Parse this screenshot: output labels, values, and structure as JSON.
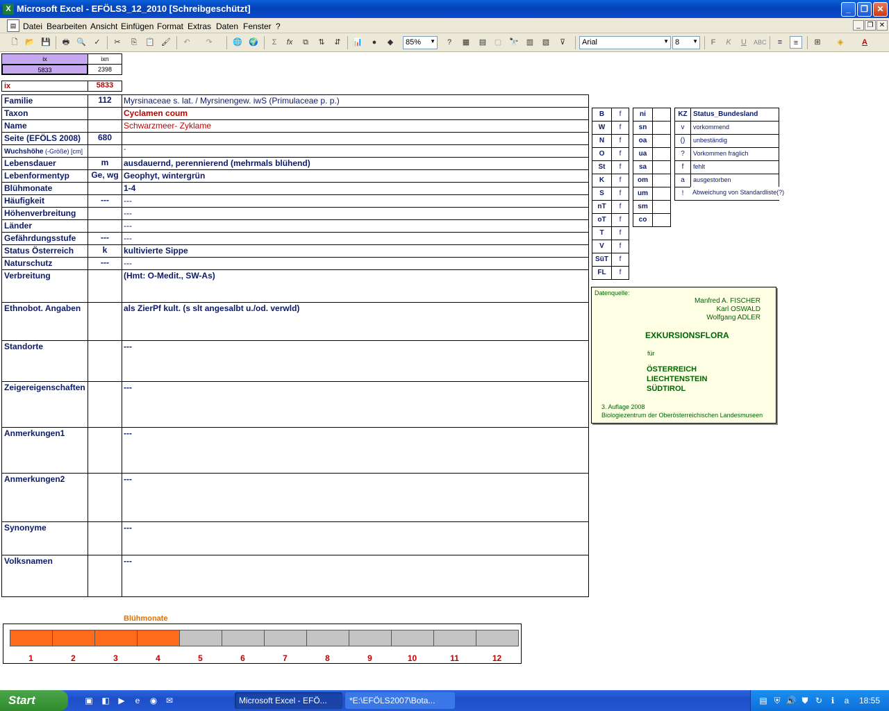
{
  "window": {
    "title": "Microsoft Excel - EFÖLS3_12_2010  [Schreibgeschützt]"
  },
  "menu": [
    "Datei",
    "Bearbeiten",
    "Ansicht",
    "Einfügen",
    "Format",
    "Extras",
    "Daten",
    "Fenster",
    "?"
  ],
  "toolbar": {
    "zoom": "85%",
    "font": "Arial",
    "size": "8"
  },
  "idx": {
    "ix_label": "ix",
    "ixn_label": "ixn",
    "ix_value": "5833",
    "ixn_value": "2398",
    "ix_label2": "ix",
    "ix_value2": "5833"
  },
  "rows": [
    {
      "label": "Familie",
      "code": "112",
      "value": "Myrsinaceae s. lat.  /  Myrsinengew. iwS (Primulaceae p. p.)"
    },
    {
      "label": "Taxon",
      "code": "",
      "value": "Cyclamen coum"
    },
    {
      "label": "Name",
      "code": "",
      "value": "Schwarzmeer- Zyklame"
    },
    {
      "label": "Seite (EFÖLS 2008)",
      "code": "680",
      "value": ""
    },
    {
      "label": "Wuchshöhe",
      "label_suffix": " (-Größe) [cm]",
      "code": "",
      "value": " -"
    },
    {
      "label": "Lebensdauer",
      "code": "m",
      "value": "ausdauernd, perennierend (mehrmals blühend)"
    },
    {
      "label": "Lebenformentyp",
      "code": "Ge, wg",
      "value": "Geophyt, wintergrün"
    },
    {
      "label": "Blühmonate",
      "code": "",
      "value": " 1-4"
    },
    {
      "label": "Häufigkeit",
      "code": "---",
      "value": " ---"
    },
    {
      "label": "Höhenverbreitung",
      "code": "",
      "value": " ---"
    },
    {
      "label": "Länder",
      "code": "",
      "value": " ---"
    },
    {
      "label": "Gefährdungsstufe",
      "code": "---",
      "value": "  ---"
    },
    {
      "label": "Status Österreich",
      "code": "k",
      "value": "kultivierte Sippe"
    },
    {
      "label": "Naturschutz",
      "code": "---",
      "value": " ---"
    },
    {
      "label": "Verbreitung",
      "code": "",
      "value": "(Hmt: O-Medit., SW-As)"
    },
    {
      "label": "Ethnobot. Angaben",
      "code": "",
      "value": "als ZierPf kult. (s slt angesalbt u./od. verwld)"
    },
    {
      "label": "Standorte",
      "code": "",
      "value": "---"
    },
    {
      "label": "Zeigereigenschaften",
      "code": "",
      "value": "---"
    },
    {
      "label": "Anmerkungen1",
      "code": "",
      "value": "---"
    },
    {
      "label": "Anmerkungen2",
      "code": "",
      "value": "---"
    },
    {
      "label": "Synonyme",
      "code": "",
      "value": "---"
    },
    {
      "label": "Volksnamen",
      "code": "",
      "value": "---"
    }
  ],
  "states": [
    {
      "code": "B",
      "flag": "f"
    },
    {
      "code": "W",
      "flag": "f"
    },
    {
      "code": "N",
      "flag": "f"
    },
    {
      "code": "O",
      "flag": "f"
    },
    {
      "code": "St",
      "flag": "f"
    },
    {
      "code": "K",
      "flag": "f"
    },
    {
      "code": "S",
      "flag": "f"
    },
    {
      "code": "nT",
      "flag": "f"
    },
    {
      "code": "oT",
      "flag": "f"
    },
    {
      "code": "T",
      "flag": "f"
    },
    {
      "code": "V",
      "flag": "f"
    },
    {
      "code": "SüT",
      "flag": "f"
    },
    {
      "code": "FL",
      "flag": "f"
    }
  ],
  "regions": [
    "ni",
    "sn",
    "oa",
    "ua",
    "sa",
    "om",
    "um",
    "sm",
    "co"
  ],
  "legend": {
    "header_kz": "KZ",
    "header_name": "Status_Bundesland",
    "items": [
      {
        "kz": "v",
        "text": "vorkommend"
      },
      {
        "kz": "()",
        "text": "unbeständig"
      },
      {
        "kz": "?",
        "text": "Vorkommen fraglich"
      },
      {
        "kz": "f",
        "text": "fehlt"
      },
      {
        "kz": "a",
        "text": "ausgestorben"
      },
      {
        "kz": "!",
        "text": "Abweichung von Standardliste(?)"
      }
    ]
  },
  "datasource": {
    "label": "Datenquelle:",
    "author1": "Manfred A. FISCHER",
    "author2": "Karl OSWALD",
    "author3": "Wolfgang ADLER",
    "title": "EXKURSIONSFLORA",
    "fuer": "für",
    "country1": "ÖSTERREICH",
    "country2": "LIECHTENSTEIN",
    "country3": "SÜDTIROL",
    "edition": "3. Auflage 2008",
    "publisher": "Biologiezentrum der Oberösterreichischen Landesmuseen"
  },
  "bloom": {
    "title": "Blühmonate",
    "months": [
      "1",
      "2",
      "3",
      "4",
      "5",
      "6",
      "7",
      "8",
      "9",
      "10",
      "11",
      "12"
    ],
    "active": [
      true,
      true,
      true,
      true,
      false,
      false,
      false,
      false,
      false,
      false,
      false,
      false
    ],
    "colors": {
      "on": "#ff6b1a",
      "off": "#c4c4c4"
    }
  },
  "taskbar": {
    "start": "Start",
    "tasks": [
      "Microsoft Excel - EFÖ...",
      "*E:\\EFÖLS2007\\Bota..."
    ],
    "clock": "18:55"
  }
}
